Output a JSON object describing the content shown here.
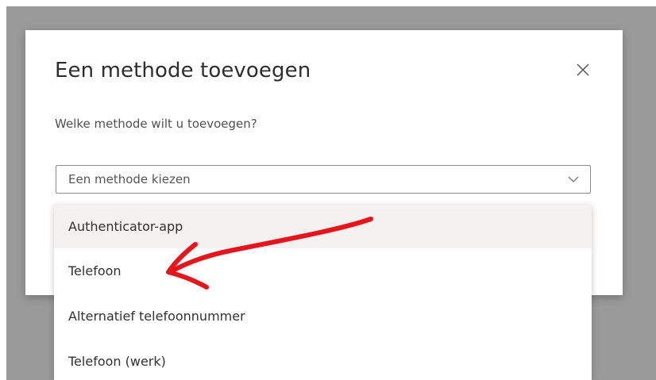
{
  "modal": {
    "title": "Een methode toevoegen",
    "question": "Welke methode wilt u toevoegen?",
    "select": {
      "value": "Een methode kiezen",
      "icon": "chevron-down-icon"
    },
    "close_icon": "close-icon"
  },
  "dropdown": {
    "options": [
      {
        "label": "Authenticator-app",
        "highlighted": true
      },
      {
        "label": "Telefoon",
        "highlighted": false
      },
      {
        "label": "Alternatief telefoonnummer",
        "highlighted": false
      },
      {
        "label": "Telefoon (werk)",
        "highlighted": false
      }
    ]
  },
  "annotation": {
    "type": "hand-drawn-arrow",
    "color": "#e8141c",
    "points_to": "Telefoon"
  }
}
